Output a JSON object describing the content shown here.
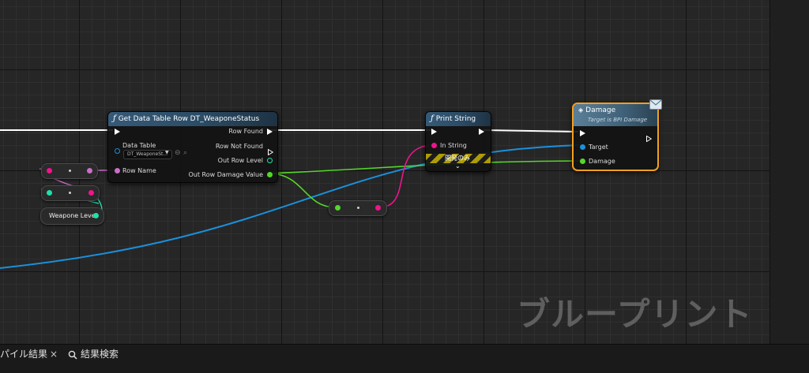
{
  "watermark": "ブループリント",
  "nodes": {
    "get_row": {
      "title": "Get Data Table Row DT_WeaponeStatus",
      "row_found": "Row Found",
      "row_not_found": "Row Not Found",
      "out_row_level": "Out Row Level",
      "out_row_damage_value": "Out Row Damage Value",
      "data_table": "Data Table",
      "data_table_value": "DT_WeaponeSt...",
      "row_name": "Row Name"
    },
    "print_string": {
      "title": "Print String",
      "in_string": "In String",
      "dev_only": "開発のみ"
    },
    "damage": {
      "title": "Damage",
      "subtitle": "Target is BPI Damage",
      "target": "Target",
      "damage": "Damage"
    },
    "weapone_level": {
      "label": "Weapone Level"
    }
  },
  "bottom_tabs": {
    "compile_results": "パイル結果",
    "close": "×",
    "find_results": "結果検索"
  },
  "colors": {
    "exec": "#ffffff",
    "name_pin": "#c86fc8",
    "int_pin": "#1fe0a8",
    "float_pin": "#56d62a",
    "string_pin": "#f0148c",
    "object_pin": "#1a90dc",
    "datatable_pin": "#1a90dc",
    "struct_pin": "#1aa0e6",
    "selection": "#f2a020"
  }
}
